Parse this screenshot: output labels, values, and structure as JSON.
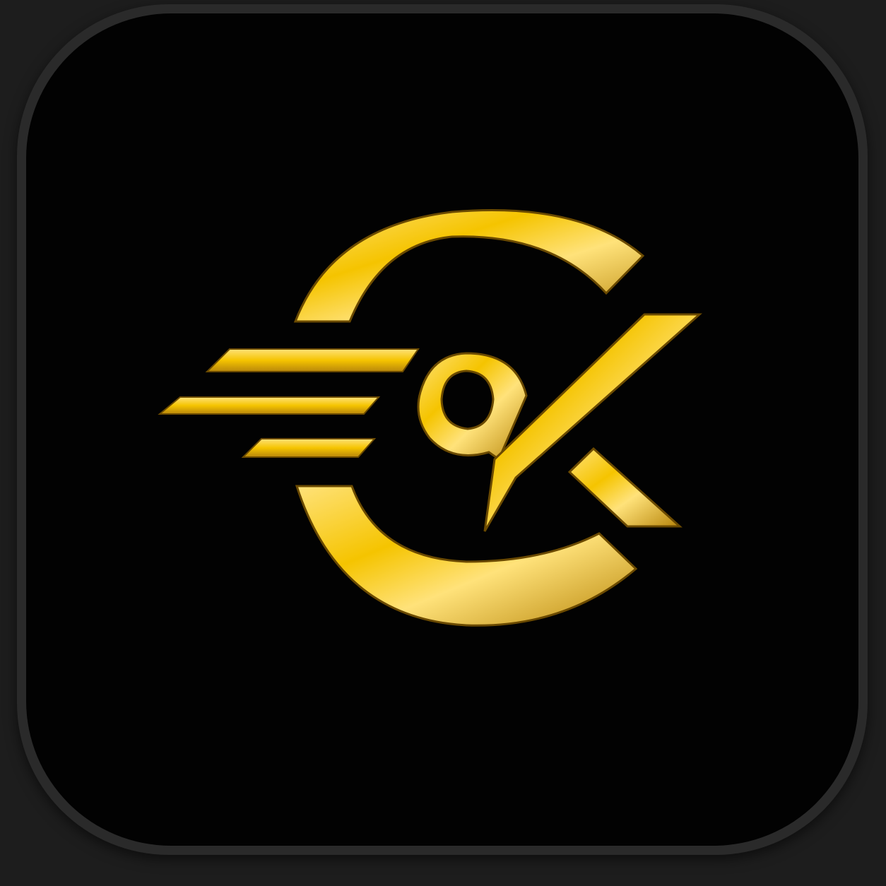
{
  "app_icon": {
    "glyph": "logo-mark-c-a-k-speed-lines",
    "colors": {
      "background": "#020202",
      "frame": "#2a2a2a",
      "outer": "#1d1d1d",
      "gold_light": "#FFE27A",
      "gold_mid": "#F5C400",
      "gold_dark": "#B8860B",
      "gold_deep": "#7A5500"
    }
  }
}
